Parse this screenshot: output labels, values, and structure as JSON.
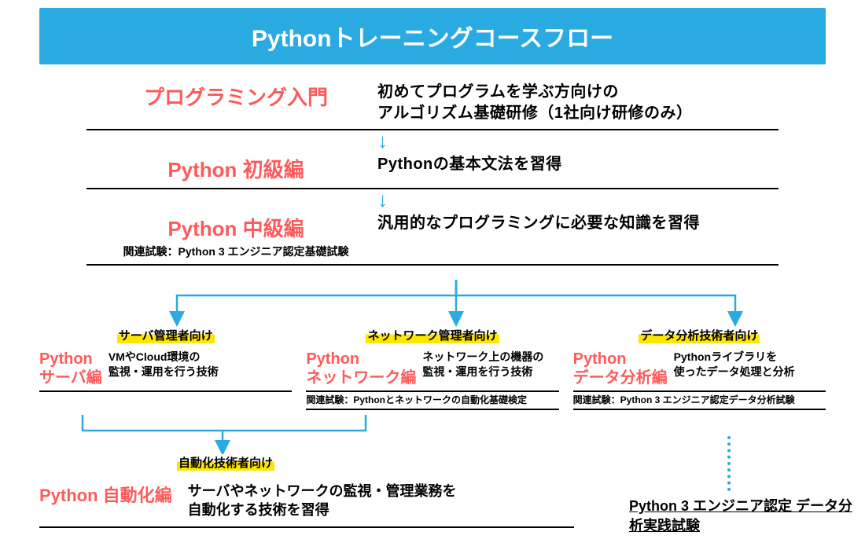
{
  "banner": "Pythonトレーニングコースフロー",
  "r1": {
    "title": "プログラミング入門",
    "desc": "初めてプログラムを学ぶ方向けの\nアルゴリズム基礎研修（1社向け研修のみ）"
  },
  "r2": {
    "title": "Python 初級編",
    "desc": "Pythonの基本文法を習得"
  },
  "r3": {
    "title": "Python 中級編",
    "sub": "関連試験：Python 3 エンジニア認定基礎試験",
    "desc": "汎用的なプログラミングに必要な知識を習得"
  },
  "tracks": [
    {
      "tag": "サーバ管理者向け",
      "title": "Python\nサーバ編",
      "desc": "VMやCloud環境の\n監視・運用を行う技術",
      "exam": ""
    },
    {
      "tag": "ネットワーク管理者向け",
      "title": "Python\nネットワーク編",
      "desc": "ネットワーク上の機器の\n監視・運用を行う技術",
      "exam": "関連試験：Pythonとネットワークの自動化基礎検定"
    },
    {
      "tag": "データ分析技術者向け",
      "title": "Python\nデータ分析編",
      "desc": "Pythonライブラリを\n使ったデータ処理と分析",
      "exam": "関連試験：Python 3 エンジニア認定データ分析試験"
    }
  ],
  "auto": {
    "tag": "自動化技術者向け",
    "title": "Python 自動化編",
    "desc": "サーバやネットワークの監視・管理業務を\n自動化する技術を習得"
  },
  "cert": "Python 3 エンジニア認定\nデータ分析実践試験",
  "arrow": "↓"
}
